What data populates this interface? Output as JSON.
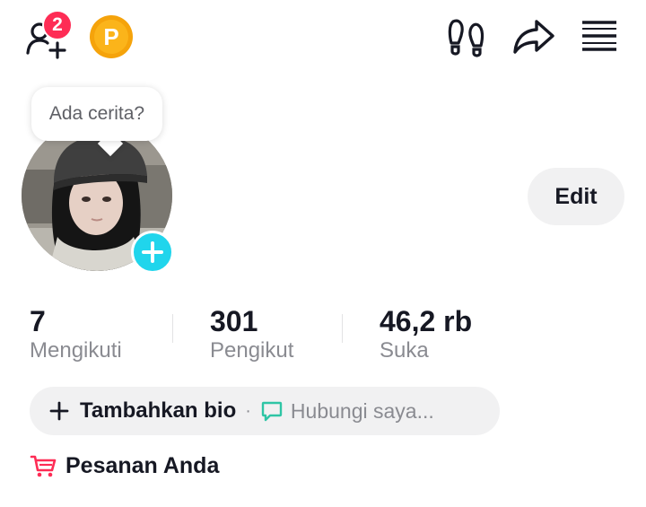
{
  "header": {
    "friend_requests_badge": "2",
    "points_label": "P",
    "icons": [
      "add-friend-icon",
      "points-coin-icon",
      "footprints-icon",
      "share-icon",
      "menu-icon"
    ]
  },
  "profile": {
    "story_prompt": "Ada cerita?",
    "edit_label": "Edit"
  },
  "stats": [
    {
      "value": "7",
      "label": "Mengikuti"
    },
    {
      "value": "301",
      "label": "Pengikut"
    },
    {
      "value": "46,2 rb",
      "label": "Suka"
    }
  ],
  "bio": {
    "add_bio": "Tambahkan bio",
    "separator": "·",
    "contact": "Hubungi saya..."
  },
  "orders": {
    "label": "Pesanan Anda"
  },
  "colors": {
    "accent_red": "#fe2c55",
    "story_add": "#20d5ec",
    "chat_green": "#2ec5a5",
    "cart_red": "#fe2c55",
    "coin": "#f5a30b"
  }
}
